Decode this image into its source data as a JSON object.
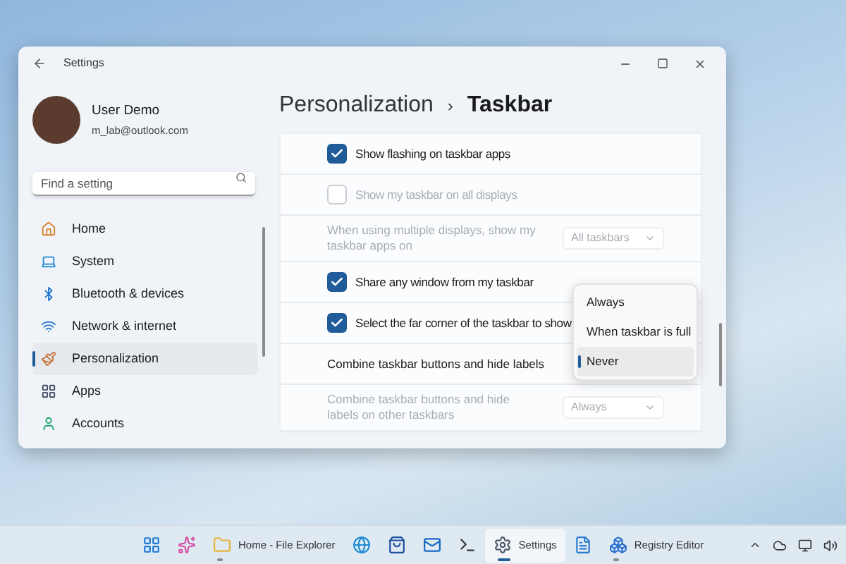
{
  "window": {
    "title": "Settings"
  },
  "user": {
    "name": "User Demo",
    "email": "m_lab@outlook.com"
  },
  "search": {
    "placeholder": "Find a setting"
  },
  "sidebar": {
    "items": [
      {
        "label": "Home",
        "selected": false
      },
      {
        "label": "System",
        "selected": false
      },
      {
        "label": "Bluetooth & devices",
        "selected": false
      },
      {
        "label": "Network & internet",
        "selected": false
      },
      {
        "label": "Personalization",
        "selected": true
      },
      {
        "label": "Apps",
        "selected": false
      },
      {
        "label": "Accounts",
        "selected": false
      }
    ]
  },
  "breadcrumb": {
    "parent": "Personalization",
    "separator": "›",
    "current": "Taskbar"
  },
  "settings": [
    {
      "kind": "checkbox",
      "label": "Show flashing on taskbar apps",
      "checked": true,
      "disabled": false
    },
    {
      "kind": "checkbox",
      "label": "Show my taskbar on all displays",
      "checked": false,
      "disabled": true
    },
    {
      "kind": "dropdown",
      "label": "When using multiple displays, show my taskbar apps on",
      "value": "All taskbars",
      "disabled": true
    },
    {
      "kind": "checkbox",
      "label": "Share any window from my taskbar",
      "checked": true,
      "disabled": false
    },
    {
      "kind": "checkbox",
      "label": "Select the far corner of the taskbar to show",
      "checked": true,
      "disabled": false
    },
    {
      "kind": "menu",
      "label": "Combine taskbar buttons and hide labels",
      "disabled": false,
      "options": [
        {
          "label": "Always",
          "selected": false
        },
        {
          "label": "When taskbar is full",
          "selected": false
        },
        {
          "label": "Never",
          "selected": true
        }
      ]
    },
    {
      "kind": "dropdown",
      "label": "Combine taskbar buttons and hide labels on other taskbars",
      "value": "Always",
      "disabled": true
    }
  ],
  "taskbar": {
    "apps": [
      {
        "running": false,
        "active": false
      },
      {
        "running": false,
        "active": false
      },
      {
        "label": "Home - File Explorer",
        "running": true,
        "active": false
      },
      {
        "running": false,
        "active": false
      },
      {
        "running": false,
        "active": false
      },
      {
        "running": false,
        "active": false
      },
      {
        "running": false,
        "active": false
      },
      {
        "label": "Settings",
        "running": true,
        "active": true
      },
      {
        "running": false,
        "active": false
      },
      {
        "label": "Registry Editor",
        "running": true,
        "active": false
      }
    ]
  }
}
